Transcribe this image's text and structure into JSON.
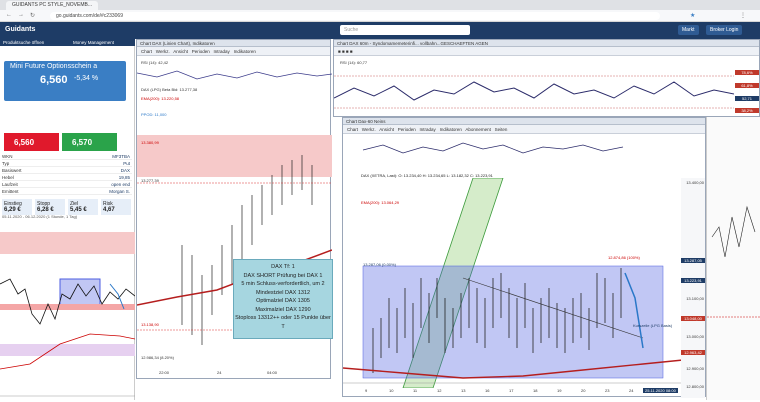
{
  "browser": {
    "tab_title": "GUIDANTS PC STYLE_NOVEMB...",
    "url": "go.guidants.com/de/#c233069"
  },
  "app": {
    "logo": "Guidants",
    "search_placeholder": "Suche",
    "buttons": [
      "Markt",
      "Broker Login"
    ]
  },
  "left_panel": {
    "header_items": [
      "Produktsuche öffnen",
      "Money Management",
      "Chart DAX (Linien Chart), Indikato"
    ],
    "quote_name": "Mini Future Optionsschein a",
    "quote_price": "6,560",
    "quote_change": "-5,34 %",
    "bid": "6,560",
    "ask": "6,570",
    "info_rows": [
      {
        "label": "WKN",
        "value": "MF3TBA"
      },
      {
        "label": "Typ",
        "value": "Put"
      },
      {
        "label": "Basiswert",
        "value": "DAX"
      },
      {
        "label": "Hebel",
        "value": "19,85"
      },
      {
        "label": "Laufzeit",
        "value": "open end"
      },
      {
        "label": "Emittent",
        "value": "Morgan S."
      }
    ],
    "stats": [
      {
        "label": "Einstieg",
        "value": "6,29 €"
      },
      {
        "label": "Stopp",
        "value": "6,28 €"
      },
      {
        "label": "Ziel",
        "value": "5,45 €"
      },
      {
        "label": "Risk",
        "value": "4,67"
      }
    ],
    "chart_footer": "05.11.2020 - 06.12.2020 (1 Stunde, 1 Tag)"
  },
  "main_chart": {
    "title": "Chart DAX (Linien Chart), Indikatoren",
    "tabs": [
      "Chart",
      "Werkz.",
      "Ansicht",
      "Perioden",
      "Intraday",
      "Indikatoren"
    ],
    "indicators": [
      "RSI (14): 42,42",
      "DAX (LPG) Beta Bid: 13.277,38",
      "EMA(200): 13.220,58",
      "PPOD: 11,000"
    ],
    "popup_lines": [
      "DAX Tf: 1",
      "DAX SHORT Prüfung bei DAX 1",
      "5 min Schluss-verfordertlich, um 2",
      "Mindestziel DAX 1312",
      "Optimalziel DAX 1305",
      "Maximalziel DAX 1290",
      "Stoploss 13312++ oder 15 Punkte über T"
    ],
    "price_labels": [
      "13.380,99",
      "13.277,39",
      "13.138,90",
      "12.986,34 (8.20%)"
    ],
    "time_labels": [
      "22:00",
      "24",
      "04:00"
    ]
  },
  "rsi_window": {
    "title": "Chart DAX 60m - Syndomamemeterinfi... vollbahn...GESCHAEFTEN AGEN",
    "indicator": "RSI (14): 60,77",
    "price_labels": [
      "78,6%",
      "61,8%",
      "52,71",
      "38,2%"
    ]
  },
  "dax_window": {
    "title": "Chart Dax-60 Neins",
    "tabs": [
      "Chart",
      "Werkz.",
      "Ansicht",
      "Perioden",
      "Intraday",
      "Indikatoren",
      "Abonnement",
      "Seiten"
    ],
    "indicators": [
      "DAX (XETRA, Last): O: 13.234,40  H: 13.234,65  L: 13.182,32  C: 13.223,91",
      "EMA(200): 13.064,29"
    ],
    "fib_labels": [
      "13.287,06 (0.00%)",
      "12.874,86 (100%)",
      "Kurszeile (LPG Basis)"
    ],
    "right_prices": [
      "13.400,00",
      "13.287,05",
      "13.223,91",
      "13.100,00",
      "13.048,00",
      "13.000,00",
      "12.963,42",
      "12.900,00",
      "12.800,00"
    ],
    "x_labels": [
      "9",
      "10",
      "11",
      "12",
      "13",
      "16",
      "17",
      "18",
      "19",
      "20",
      "23",
      "24"
    ],
    "date_badge": "25.11.2020 08:00"
  },
  "colors": {
    "header": "#1e3c66",
    "bid": "#e0192c",
    "ask": "#2aa34a",
    "quote": "#3a7ec4",
    "fib_fill": "#4c5ee0",
    "channel_fill": "#b9e0a6"
  }
}
